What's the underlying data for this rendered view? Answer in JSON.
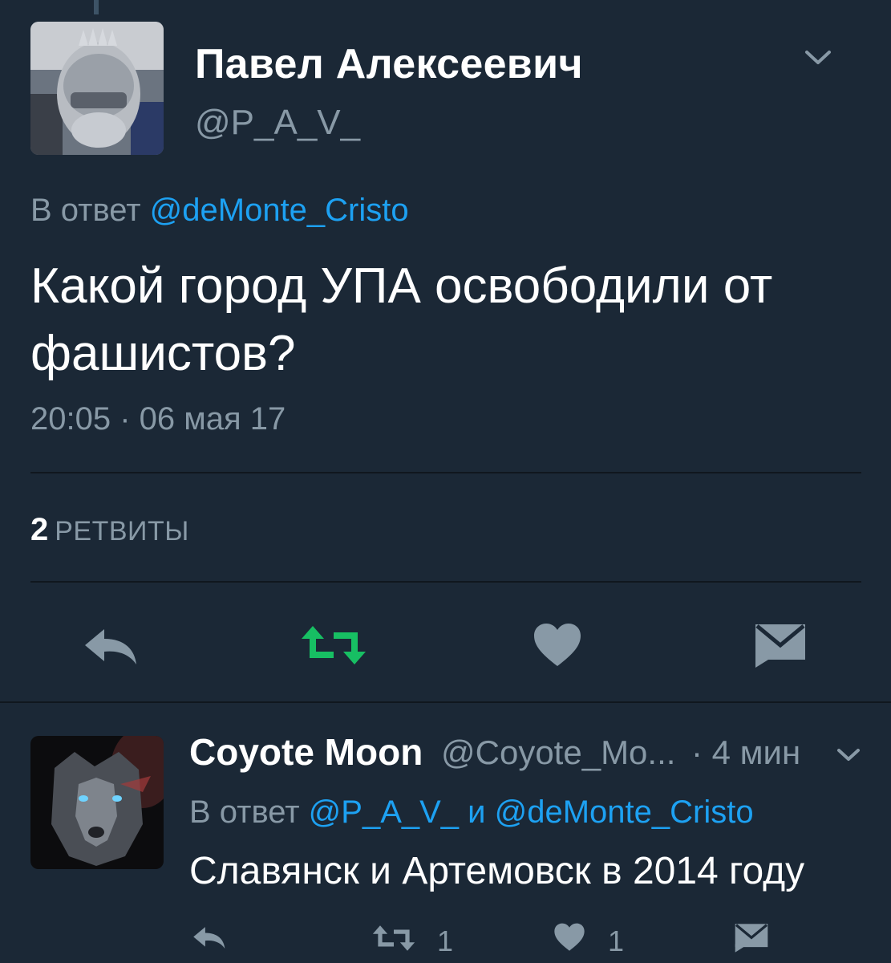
{
  "colors": {
    "background": "#1b2836",
    "link": "#1da1f2",
    "muted": "#8899a6",
    "retweet_active": "#17bf63",
    "icon": "#8899a6"
  },
  "main_tweet": {
    "author_name": "Павел Алексеевич",
    "author_handle": "@P_A_V_",
    "reply_prefix": "В ответ",
    "reply_to": "@deMonte_Cristo",
    "text": "Какой город УПА освободили от фашистов?",
    "timestamp": "20:05 · 06 мая 17",
    "retweet_count": "2",
    "retweet_label": "РЕТВИТЫ",
    "actions": [
      "reply-icon",
      "retweet-icon",
      "heart-icon",
      "message-icon"
    ]
  },
  "reply_tweet": {
    "author_name": "Coyote Moon",
    "author_handle": "@Coyote_Mo...",
    "time": "· 4 мин",
    "reply_prefix": "В ответ",
    "reply_to_1": "@P_A_V_",
    "reply_joiner": "и",
    "reply_to_2": "@deMonte_Cristo",
    "text": "Славянск и Артемовск в 2014 году",
    "retweet_count": "1",
    "like_count": "1"
  }
}
